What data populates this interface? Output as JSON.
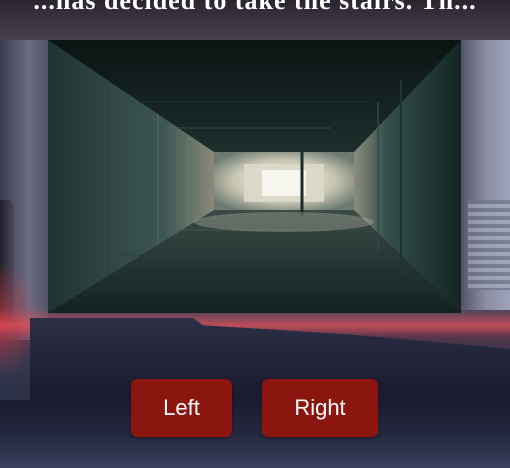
{
  "header": {
    "text": "...has decided to take the stairs. Th..."
  },
  "scene": {
    "description_icon": "corridor-view"
  },
  "controls": {
    "left_label": "Left",
    "right_label": "Right"
  },
  "colors": {
    "button_bg": "#8a160f",
    "button_text": "#ffffff"
  }
}
